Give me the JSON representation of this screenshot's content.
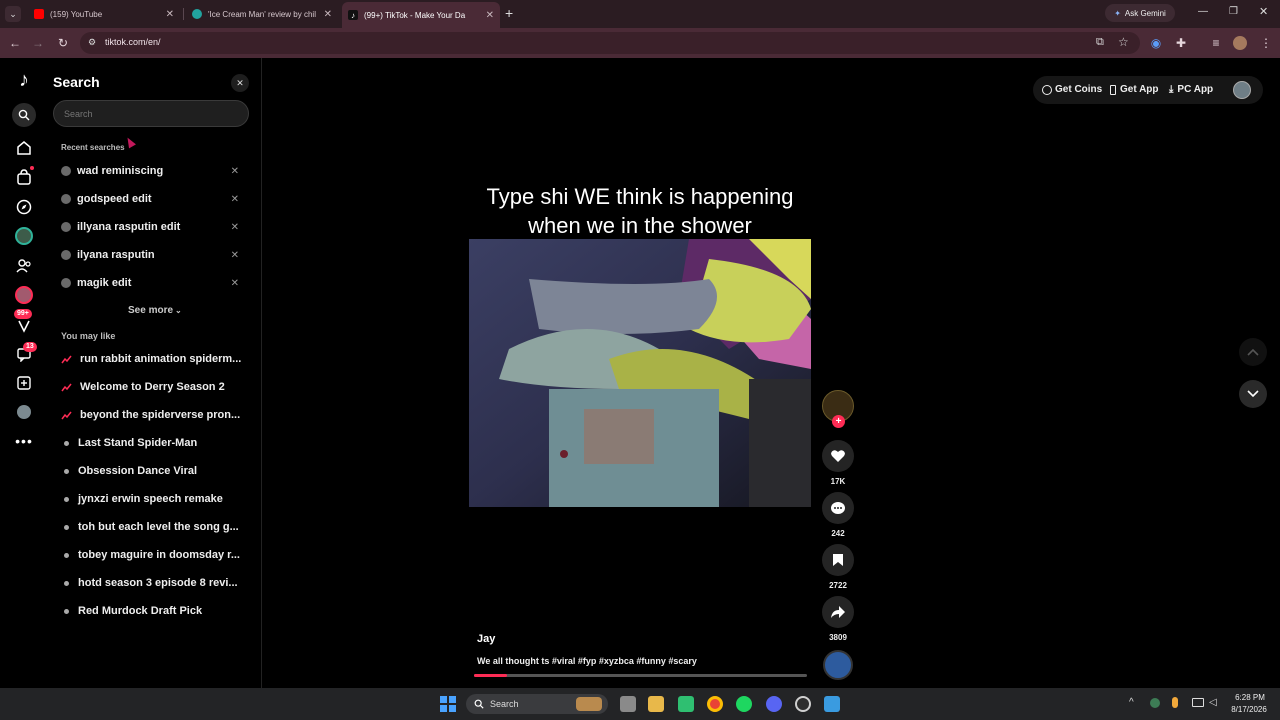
{
  "browser": {
    "tabs": [
      {
        "title": "(159) YouTube",
        "color": "#ff0000"
      },
      {
        "title": "'Ice Cream Man' review by chil",
        "color": "#22a39f"
      },
      {
        "title": "(99+) TikTok - Make Your Da",
        "color": "#111111"
      }
    ],
    "ask_gemini": "Ask Gemini",
    "url": "tiktok.com/en/"
  },
  "search_panel": {
    "title": "Search",
    "search_placeholder": "Search",
    "recent_heading": "Recent searches",
    "recent": [
      "wad reminiscing",
      "godspeed edit",
      "illyana rasputin edit",
      "ilyana rasputin",
      "magik edit"
    ],
    "see_more": "See more",
    "you_may_like_heading": "You may like",
    "you_may_like": [
      {
        "text": "run rabbit animation spiderm...",
        "trending": true
      },
      {
        "text": "Welcome to Derry Season 2",
        "trending": true
      },
      {
        "text": "beyond the spiderverse pron...",
        "trending": true
      },
      {
        "text": "Last Stand Spider-Man",
        "trending": false
      },
      {
        "text": "Obsession Dance Viral",
        "trending": false
      },
      {
        "text": "jynxzi erwin speech remake",
        "trending": false
      },
      {
        "text": "toh but each level the song g...",
        "trending": false
      },
      {
        "text": "tobey maguire in doomsday r...",
        "trending": false
      },
      {
        "text": "hotd season 3 episode 8 revi...",
        "trending": false
      },
      {
        "text": "Red Murdock Draft Pick",
        "trending": false
      }
    ]
  },
  "rail_badges": {
    "activity": "99+",
    "messages": "13"
  },
  "top_right": {
    "get_coins": "Get Coins",
    "get_app": "Get App",
    "pc_app": "PC App"
  },
  "video": {
    "caption": "Type shi WE think is happening when we in the shower",
    "author": "Jay",
    "description": "We all thought ts #viral #fyp #xyzbca #funny #scary",
    "likes": "17K",
    "comments": "242",
    "saves": "2722",
    "shares": "3809",
    "progress": 0.1
  },
  "taskbar": {
    "search_label": "Search",
    "time": "6:28 PM",
    "date": "8/17/2026"
  },
  "colors": {
    "tiktok_pink": "#fe2c55",
    "tab_bar": "#2b1c22",
    "toolbar": "#4a2a36"
  }
}
